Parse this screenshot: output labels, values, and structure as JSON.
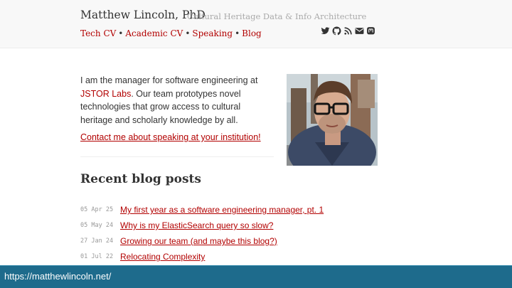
{
  "header": {
    "title": "Matthew Lincoln, PhD",
    "subtitle": "Cultural Heritage Data & Info Architecture",
    "nav": [
      {
        "label": "Tech CV"
      },
      {
        "label": "Academic CV"
      },
      {
        "label": "Speaking"
      },
      {
        "label": "Blog"
      }
    ],
    "nav_separator": "•",
    "social_icons": [
      "twitter-icon",
      "github-icon",
      "rss-icon",
      "email-icon",
      "mastodon-icon"
    ]
  },
  "intro": {
    "text": "I am the manager for software engineering at ",
    "link": "JSTOR Labs",
    "text_after": ". Our team prototypes novel technologies that grow access to cultural heritage and scholarly knowledge by all.",
    "contact": "Contact me about speaking at your institution!"
  },
  "blog": {
    "heading": "Recent blog posts",
    "posts": [
      {
        "date": "05 Apr 25",
        "title": "My first year as a software engineering manager, pt. 1"
      },
      {
        "date": "05 May 24",
        "title": "Why is my ElasticSearch query so slow?"
      },
      {
        "date": "27 Jan 24",
        "title": "Growing our team (and maybe this blog?)"
      },
      {
        "date": "01 Jul 22",
        "title": "Relocating Complexity"
      }
    ]
  },
  "statusbar": {
    "url": "https://matthewlincoln.net/"
  },
  "colors": {
    "link": "#b20000",
    "statusbar": "#1e6b8c",
    "header_bg": "#f8f8f8"
  }
}
